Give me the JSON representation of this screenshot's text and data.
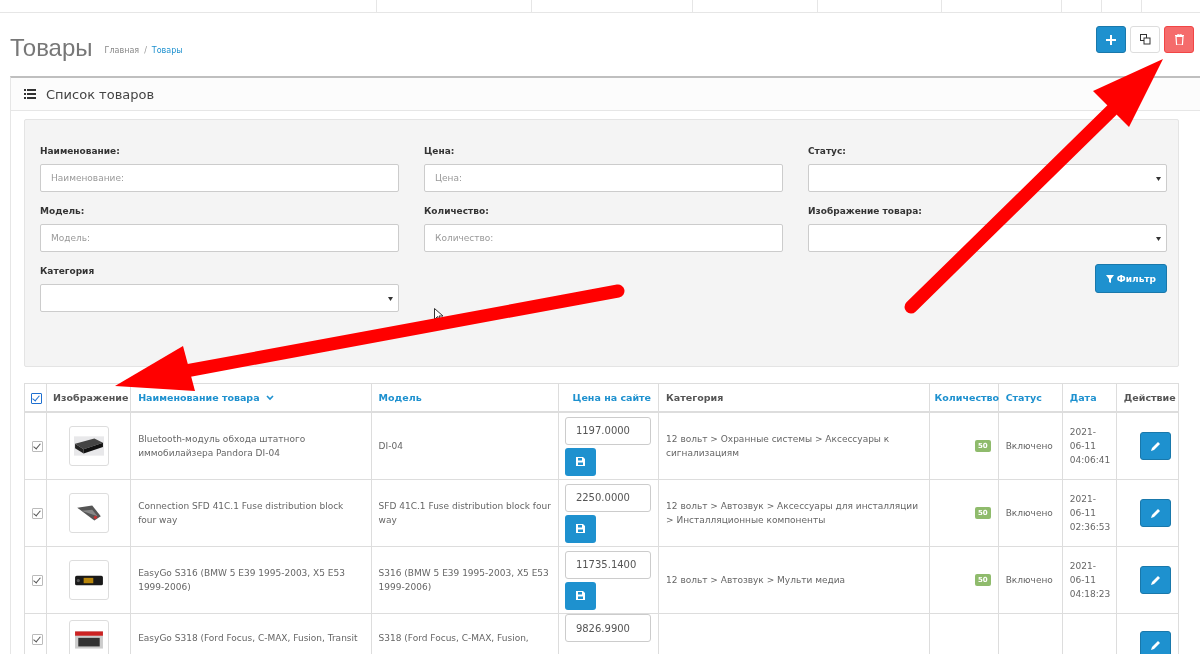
{
  "page": {
    "title": "Товары",
    "breadcrumb_separator": "/",
    "breadcrumbs": [
      {
        "label": "Главная",
        "current": false
      },
      {
        "label": "Товары",
        "current": true
      }
    ]
  },
  "toolbar": [
    {
      "kind": "add"
    },
    {
      "kind": "copy"
    },
    {
      "kind": "delete"
    }
  ],
  "panel": {
    "title": "Список товаров"
  },
  "filter": {
    "fields": [
      {
        "label": "Наименование:",
        "kind": "input",
        "placeholder": "Наименование:"
      },
      {
        "label": "Цена:",
        "kind": "input",
        "placeholder": "Цена:"
      },
      {
        "label": "Статус:",
        "kind": "select"
      },
      {
        "label": "Модель:",
        "kind": "input",
        "placeholder": "Модель:"
      },
      {
        "label": "Количество:",
        "kind": "input",
        "placeholder": "Количество:"
      },
      {
        "label": "Изображение товара:",
        "kind": "select"
      },
      {
        "label": "Категория",
        "kind": "select"
      }
    ],
    "button": "Фильтр"
  },
  "table": {
    "all_checked": true,
    "columns": [
      {
        "label": "Изображение",
        "sortable": false,
        "sorted": false
      },
      {
        "label": "Наименование товара",
        "sortable": true,
        "sorted": true
      },
      {
        "label": "Модель",
        "sortable": true,
        "sorted": false
      },
      {
        "label": "Цена на сайте",
        "sortable": true,
        "sorted": false
      },
      {
        "label": "Категория",
        "sortable": false,
        "sorted": false
      },
      {
        "label": "Количество",
        "sortable": true,
        "sorted": false
      },
      {
        "label": "Статус",
        "sortable": true,
        "sorted": false
      },
      {
        "label": "Дата",
        "sortable": true,
        "sorted": false
      },
      {
        "label": "Действие",
        "sortable": false,
        "sorted": false
      }
    ],
    "rows": [
      {
        "checked": true,
        "name": "Bluetooth-модуль обхода штатного иммобилайзера Pandora DI-04",
        "model": "DI-04",
        "price": "1197.0000",
        "category": "12 вольт  >  Охранные системы  >  Аксессуары к сигнализациям",
        "quantity": "50",
        "status": "Включено",
        "date": "2021-06-11 04:06:41"
      },
      {
        "checked": true,
        "name": "Connection SFD 41C.1 Fuse distribution block four way",
        "model": "SFD 41C.1 Fuse distribution block four way",
        "price": "2250.0000",
        "category": "12 вольт  >  Автозвук  >  Аксессуары для инсталляции  >  Инсталляционные компоненты",
        "quantity": "50",
        "status": "Включено",
        "date": "2021-06-11 02:36:53"
      },
      {
        "checked": true,
        "name": "EasyGo S316 (BMW 5 E39 1995-2003, X5 E53 1999-2006)",
        "model": "S316 (BMW 5 E39 1995-2003, X5 E53 1999-2006)",
        "price": "11735.1400",
        "category": "12 вольт  >  Автозвук  >  Мульти медиа",
        "quantity": "50",
        "status": "Включено",
        "date": "2021-06-11 04:18:23"
      },
      {
        "checked": true,
        "name": "EasyGo S318 (Ford Focus, C-MAX, Fusion, Transit",
        "model": "S318 (Ford Focus, C-MAX, Fusion,",
        "price": "9826.9900"
      }
    ]
  }
}
